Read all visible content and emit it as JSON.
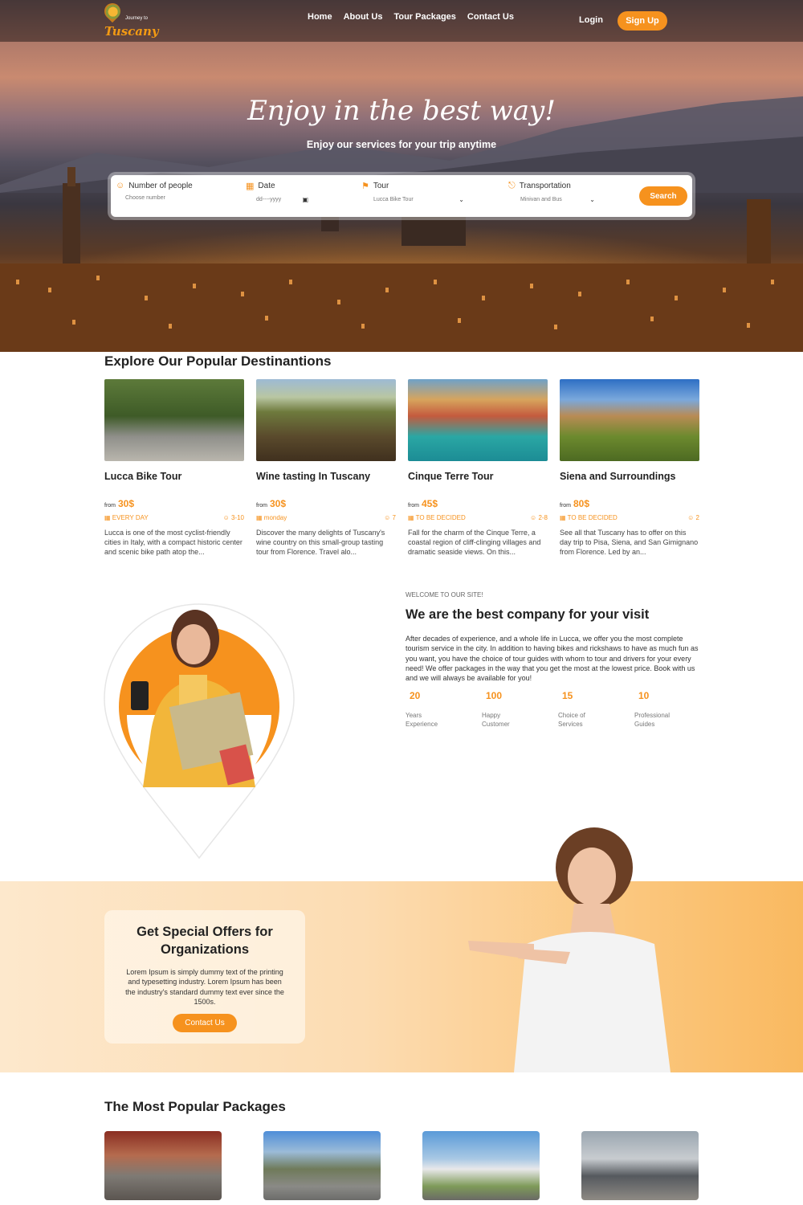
{
  "brand": {
    "small": "Journey to",
    "name": "Tuscany"
  },
  "nav": {
    "items": [
      "Home",
      "About Us",
      "Tour Packages",
      "Contact Us"
    ],
    "login": "Login",
    "signup": "Sign Up"
  },
  "hero": {
    "title": "Enjoy in the best way!",
    "subtitle": "Enjoy our services for your trip anytime"
  },
  "search": {
    "people": {
      "label": "Number of people",
      "placeholder": "Choose number"
    },
    "date": {
      "label": "Date",
      "placeholder": "dd----yyyy"
    },
    "tour": {
      "label": "Tour",
      "value": "Lucca Bike Tour"
    },
    "transport": {
      "label": "Transportation",
      "value": "Minivan and Bus"
    },
    "button": "Search"
  },
  "destinations": {
    "title": "Explore Our Popular Destinantions",
    "items": [
      {
        "name": "Lucca Bike Tour",
        "from": "from",
        "price": "30$",
        "when": "EVERY DAY",
        "people": "3-10",
        "desc": "Lucca is one of the most cyclist-friendly cities in Italy, with a compact historic center and scenic bike path atop the..."
      },
      {
        "name": "Wine tasting In Tuscany",
        "from": "from",
        "price": "30$",
        "when": "monday",
        "people": "7",
        "desc": "Discover the many delights of Tuscany's wine country on this small-group tasting tour from Florence. Travel alo..."
      },
      {
        "name": "Cinque Terre Tour",
        "from": "from",
        "price": "45$",
        "when": "TO BE DECIDED",
        "people": "2-8",
        "desc": "Fall for the charm of the Cinque Terre, a coastal region of cliff-clinging villages and dramatic seaside views. On this..."
      },
      {
        "name": "Siena and Surroundings",
        "from": "from",
        "price": "80$",
        "when": "TO BE DECIDED",
        "people": "2",
        "desc": "See all that Tuscany has to offer on this day trip to Pisa, Siena, and San Gimignano from Florence. Led by an..."
      }
    ]
  },
  "about": {
    "welcome": "WELCOME TO OUR SITE!",
    "title": "We are the best company for your visit",
    "text": "After decades of experience, and a whole life in Lucca, we offer you the most complete tourism service in the city. In addition to having bikes and rickshaws to have as much fun as you want, you have the choice of tour guides with whom to tour and drivers for your every need! We offer packages in the way that you get the most at the lowest price. Book with us and we will always be available for you!",
    "stats": [
      {
        "num": "20",
        "label": "Years\nExperience"
      },
      {
        "num": "100",
        "label": "Happy\nCustomer"
      },
      {
        "num": "15",
        "label": "Choice of\nServices"
      },
      {
        "num": "10",
        "label": "Professional\nGuides"
      }
    ]
  },
  "offers": {
    "title": "Get Special Offers for Organizations",
    "text": "Lorem Ipsum is simply dummy text of the printing and typesetting industry. Lorem Ipsum has been the industry's standard dummy text ever since the 1500s.",
    "button": "Contact Us"
  },
  "packages": {
    "title": "The Most Popular Packages"
  },
  "colors": {
    "accent": "#f6921e"
  }
}
